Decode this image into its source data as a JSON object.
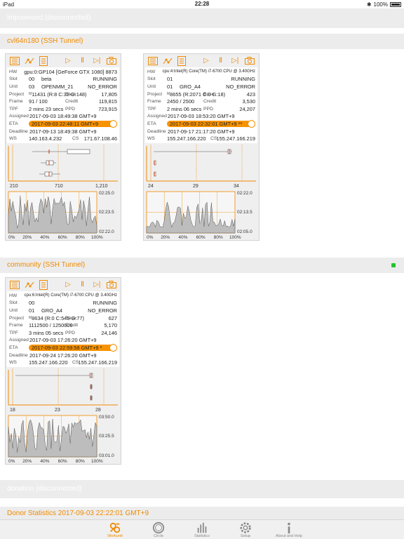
{
  "status_bar": {
    "device": "iPad",
    "time": "22:28",
    "battery": "100%"
  },
  "unreachable_host": "lmpoweoed (disconnected)",
  "donation_host": "donation (disconnected)",
  "hosts": [
    {
      "name": "cvl64n180 (SSH Tunnel)",
      "online": false,
      "slots": [
        {
          "hw": "gpu:0:GP104 [GeForce GTX 1080] 8873",
          "slot": "00",
          "slot_name": "beta",
          "state": "RUNNING",
          "unit": "03",
          "core": "OPENMM_21",
          "result": "NO_ERROR",
          "project": "11431 (R:8 C:32 G:148)",
          "base": "17,805",
          "frame": "91 / 100",
          "credit": "119,815",
          "tpf": "2 mins 23 secs",
          "ppd": "723,915",
          "assigned": "2017-09-03 18:49:38 GMT+9",
          "eta": "2017-09-03 22:48:11 GMT+9",
          "deadline": "2017-09-13 18:49:38 GMT+9",
          "ws": "140.163.4.232",
          "cs": "171.67.108.46",
          "x_ticks": [
            "210",
            "710",
            "1,210"
          ],
          "y_ticks": [
            "02:25.0",
            "02:23.5",
            "02:22.0"
          ],
          "pct_ticks": [
            "0%",
            "20%",
            "40%",
            "60%",
            "80%",
            "100%"
          ]
        },
        {
          "hw": "cpu:4:Intel(R) Core(TM) i7-6700 CPU @ 3.40GHz",
          "slot": "01",
          "slot_name": "",
          "state": "RUNNING",
          "unit": "01",
          "core": "GRO_A4",
          "result": "NO_ERROR",
          "project": "8655 (R:2071 C:0 G:18)",
          "base": "423",
          "frame": "2450 / 2500",
          "credit": "3,530",
          "tpf": "2 mins 06 secs",
          "ppd": "24,207",
          "assigned": "2017-09-03 18:53:20 GMT+9",
          "eta": "2017-09-03 22:32:01 GMT+9 **",
          "deadline": "2017-09-17 21:17:20 GMT+9",
          "ws": "155.247.166.220",
          "cs": "155.247.166.219",
          "x_ticks": [
            "24",
            "29",
            "34"
          ],
          "y_ticks": [
            "02:22.0",
            "02:13.5",
            "02:05.0"
          ],
          "pct_ticks": [
            "0%",
            "20%",
            "40%",
            "60%",
            "80%",
            "100%"
          ]
        }
      ]
    },
    {
      "name": "community (SSH Tunnel)",
      "online": true,
      "slots": [
        {
          "hw": "cpu:6:Intel(R) Core(TM) i7-6700 CPU @ 3.40GHz",
          "slot": "00",
          "slot_name": "",
          "state": "RUNNING",
          "unit": "01",
          "core": "GRO_A4",
          "result": "NO_ERROR",
          "project": "8634 (R:0 C:545 G:77)",
          "base": "627",
          "frame": "1112500 / 1250000",
          "credit": "5,170",
          "tpf": "3 mins 05 secs",
          "ppd": "24,146",
          "assigned": "2017-09-03 17:26:20 GMT+9",
          "eta": "2017-09-03 22:59:58 GMT+9 *",
          "deadline": "2017-09-24 17:26:20 GMT+9",
          "ws": "155.247.166.220",
          "cs": "155.247.166.219",
          "x_ticks": [
            "18",
            "23",
            "28"
          ],
          "y_ticks": [
            "03:50.0",
            "03:25.5",
            "03:01.0"
          ],
          "pct_ticks": [
            "0%",
            "20%",
            "40%",
            "60%",
            "80%",
            "100%"
          ]
        }
      ]
    }
  ],
  "labels": {
    "hw": "HW",
    "slot": "Slot",
    "unit": "Unit",
    "project": "Project",
    "project_marker": "M",
    "base": "Base",
    "frame": "Frame",
    "credit": "Credit",
    "tpf": "TPF",
    "ppd": "PPD",
    "assigned": "Assigned",
    "eta": "ETA",
    "deadline": "Deadline",
    "ws": "WS",
    "cs": "CS"
  },
  "donor_stats": "Donor Statistics 2017-09-03 22:22:01 GMT+9",
  "tabs": [
    {
      "label": "Workunit",
      "icon": "workunit-icon",
      "active": true
    },
    {
      "label": "Circle",
      "icon": "circle-icon",
      "active": false
    },
    {
      "label": "Statistics",
      "icon": "statistics-icon",
      "active": false
    },
    {
      "label": "Setup",
      "icon": "setup-gear-icon",
      "active": false
    },
    {
      "label": "About and Help",
      "icon": "info-icon",
      "active": false
    }
  ],
  "colors": {
    "accent": "#f08a00",
    "online": "#22c42a",
    "header_bg": "#ececec"
  }
}
